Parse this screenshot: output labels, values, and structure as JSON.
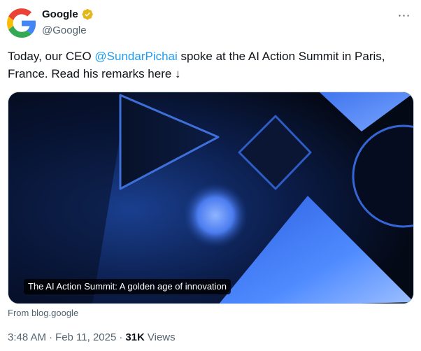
{
  "author": {
    "display_name": "Google",
    "handle": "@Google"
  },
  "icons": {
    "avatar": "google-g-logo",
    "verified": "gold-verified-badge-icon",
    "more": "more-options-icon"
  },
  "colors": {
    "mention": "#1d9bf0",
    "secondary_text": "#536471",
    "verified_gold": "#e2b719"
  },
  "tweet": {
    "text_before": "Today, our CEO ",
    "mention": "@SundarPichai",
    "text_after": " spoke at the AI Action Summit in Paris, France. Read his remarks here ↓"
  },
  "card": {
    "caption": "The AI Action Summit: A golden age of innovation",
    "source": "From blog.google"
  },
  "meta": {
    "time": "3:48 AM",
    "separator": "·",
    "date": "Feb 11, 2025",
    "views_count": "31K",
    "views_label": "Views"
  }
}
